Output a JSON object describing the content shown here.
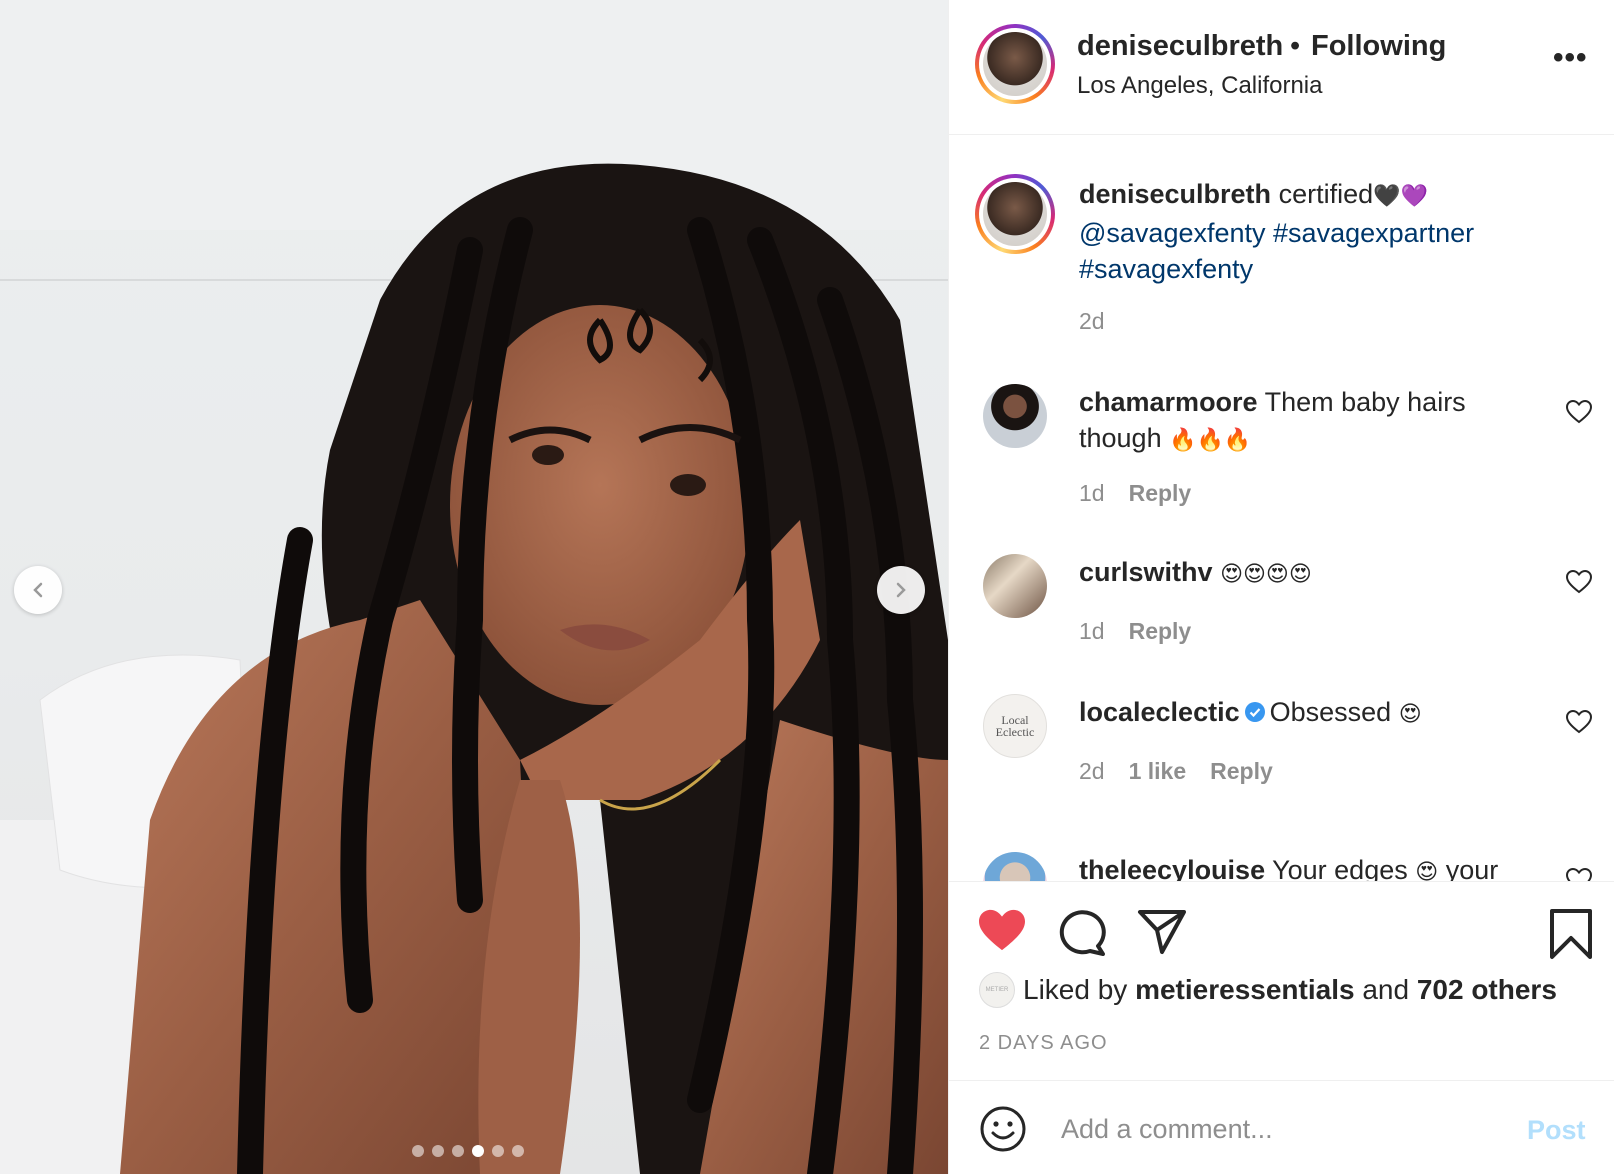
{
  "post": {
    "author": "deniseculbreth",
    "follow_status": "Following",
    "separator": "•",
    "location": "Los Angeles, California",
    "more_icon": "more-horizontal-icon",
    "carousel": {
      "slide_count": 6,
      "active_slide": 4
    }
  },
  "caption": {
    "username": "deniseculbreth",
    "text": "certified",
    "emojis": "🖤💜",
    "mention": "@savagexfenty",
    "hashtags": [
      "#savagexpartner",
      "#savagexfenty"
    ],
    "time": "2d"
  },
  "comments": [
    {
      "username": "chamarmoore",
      "text": "Them baby hairs though",
      "emojis": "🔥🔥🔥",
      "time": "1d",
      "likes": "",
      "reply": "Reply",
      "verified": false
    },
    {
      "username": "curlswithv",
      "text": "",
      "emojis": "😍😍😍😍",
      "time": "1d",
      "likes": "",
      "reply": "Reply",
      "verified": false
    },
    {
      "username": "localeclectic",
      "text": "Obsessed",
      "emojis": "😍",
      "time": "2d",
      "likes": "1 like",
      "reply": "Reply",
      "verified": true,
      "avatar_text": "Local Eclectic"
    },
    {
      "username": "theleecylouise",
      "text": "Your edges",
      "emojis": "😍",
      "text_tail": "your",
      "time": "",
      "likes": "",
      "reply": "",
      "verified": false
    }
  ],
  "actions": {
    "liked_by_prefix": "Liked by",
    "liked_by_user": "metieressentials",
    "liked_by_and": "and",
    "liked_by_others": "702 others",
    "liked_by_avatar_text": "METIER",
    "timestamp": "2 DAYS AGO"
  },
  "add_comment": {
    "placeholder": "Add a comment...",
    "post_label": "Post"
  },
  "colors": {
    "heart_red": "#ed4956",
    "link_blue": "#00376b",
    "verified_blue": "#3897f0",
    "post_disabled": "#b2dffc",
    "secondary_text": "#8e8e8e"
  }
}
